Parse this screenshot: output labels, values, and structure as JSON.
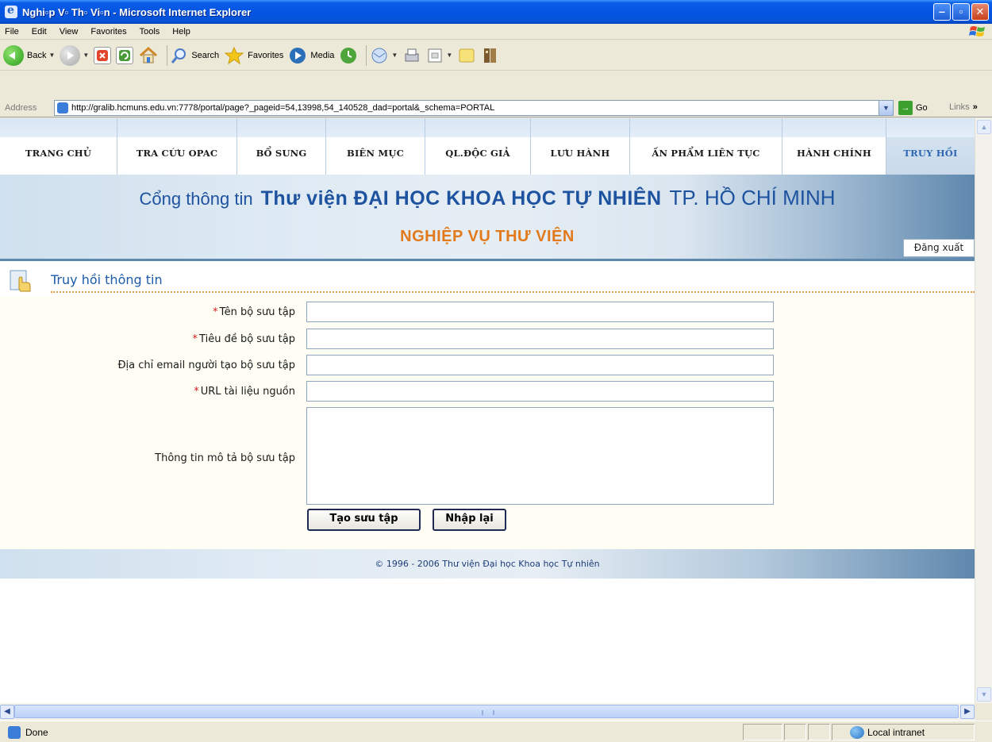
{
  "window": {
    "title": "Nghi▫p V▫ Th▫ Vi▫n - Microsoft Internet Explorer",
    "controls": [
      "minimize",
      "maximize",
      "close"
    ]
  },
  "menubar": {
    "items": [
      "File",
      "Edit",
      "View",
      "Favorites",
      "Tools",
      "Help"
    ]
  },
  "toolbar": {
    "back_label": "Back",
    "search_label": "Search",
    "favorites_label": "Favorites",
    "media_label": "Media"
  },
  "addressbar": {
    "label": "Address",
    "url": "http://gralib.hcmuns.edu.vn:7778/portal/page?_pageid=54,13998,54_140528_dad=portal&_schema=PORTAL",
    "go_label": "Go",
    "links_label": "Links"
  },
  "nav": {
    "tabs": [
      {
        "label": "TRANG CHỦ"
      },
      {
        "label": "TRA CỨU OPAC"
      },
      {
        "label": "BỔ SUNG"
      },
      {
        "label": "BIÊN MỤC"
      },
      {
        "label": "QL.ĐỘC GIẢ"
      },
      {
        "label": "LƯU HÀNH"
      },
      {
        "label": "ẤN PHẨM LIÊN TỤC"
      },
      {
        "label": "HÀNH CHÍNH"
      },
      {
        "label": "TRUY HỒI"
      }
    ],
    "active": "TRUY HỒI"
  },
  "banner": {
    "line1_prefix": "Cổng thông tin",
    "line1_main": "Thư viện ĐẠI HỌC KHOA HỌC TỰ NHIÊN",
    "line1_suffix": "TP. HỒ CHÍ MINH",
    "line2": "NGHIỆP VỤ THƯ VIỆN",
    "logout_label": "Đăng xuất"
  },
  "section": {
    "title": "Truy hồi thông tin"
  },
  "form": {
    "required_mark": "*",
    "fields": [
      {
        "label": "Tên bộ sưu tập",
        "required": true,
        "value": ""
      },
      {
        "label": "Tiêu đề bộ sưu tập",
        "required": true,
        "value": ""
      },
      {
        "label": "Địa chỉ email người tạo bộ sưu tập",
        "required": false,
        "value": ""
      },
      {
        "label": "URL tài liệu nguồn",
        "required": true,
        "value": ""
      },
      {
        "label": "Thông tin mô tả bộ sưu tập",
        "required": false,
        "value": ""
      }
    ],
    "submit_label": "Tạo sưu tập",
    "reset_label": "Nhập lại"
  },
  "footer": {
    "text": "© 1996 - 2006 Thư viện Đại học Khoa học Tự nhiên"
  },
  "statusbar": {
    "status": "Done",
    "zone": "Local intranet"
  },
  "colors": {
    "accent": "#1d5aa8",
    "orange": "#e27a1c",
    "required": "#d42020",
    "titlebar": "#0554e3"
  }
}
